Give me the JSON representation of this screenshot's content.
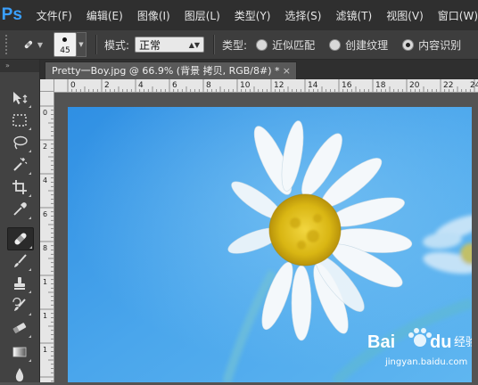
{
  "app": {
    "logo": "Ps",
    "menu": [
      "文件(F)",
      "编辑(E)",
      "图像(I)",
      "图层(L)",
      "类型(Y)",
      "选择(S)",
      "滤镜(T)",
      "视图(V)",
      "窗口(W)"
    ]
  },
  "options": {
    "brush_size": "45",
    "mode_label": "模式:",
    "mode_value": "正常",
    "type_label": "类型:",
    "radios": [
      {
        "label": "近似匹配",
        "checked": false
      },
      {
        "label": "创建纹理",
        "checked": false
      },
      {
        "label": "内容识别",
        "checked": true
      }
    ]
  },
  "toolbar": {
    "collapse_glyph": "»",
    "tools": [
      {
        "icon": "move-icon",
        "active": false
      },
      {
        "icon": "rectangular-marquee-icon",
        "active": false
      },
      {
        "icon": "lasso-icon",
        "active": false
      },
      {
        "icon": "magic-wand-icon",
        "active": false
      },
      {
        "icon": "crop-icon",
        "active": false
      },
      {
        "icon": "eyedropper-icon",
        "active": false
      },
      {
        "icon": "spot-healing-brush-icon",
        "active": true
      },
      {
        "icon": "brush-icon",
        "active": false
      },
      {
        "icon": "clone-stamp-icon",
        "active": false
      },
      {
        "icon": "history-brush-icon",
        "active": false
      },
      {
        "icon": "eraser-icon",
        "active": false
      },
      {
        "icon": "gradient-icon",
        "active": false
      },
      {
        "icon": "blur-icon",
        "active": false
      }
    ]
  },
  "document": {
    "tab_title": "Pretty一Boy.jpg @ 66.9% (背景 拷贝, RGB/8#) *",
    "close_glyph": "×"
  },
  "rulers": {
    "h_labels": [
      "0",
      "2",
      "4",
      "6",
      "8",
      "10",
      "12",
      "14",
      "16",
      "18",
      "20",
      "22",
      "24"
    ],
    "v_labels": [
      "0",
      "2",
      "4",
      "6",
      "8",
      "1",
      "1",
      "1"
    ]
  },
  "watermark": {
    "brand_bai": "Bai",
    "brand_du": "du",
    "brand_cn": "经验",
    "url": "jingyan.baidu.com"
  },
  "colors": {
    "accent": "#3aa0ff",
    "sky": "#4aa6ec",
    "petal": "#f4f8fb",
    "center": "#e2c21a"
  }
}
